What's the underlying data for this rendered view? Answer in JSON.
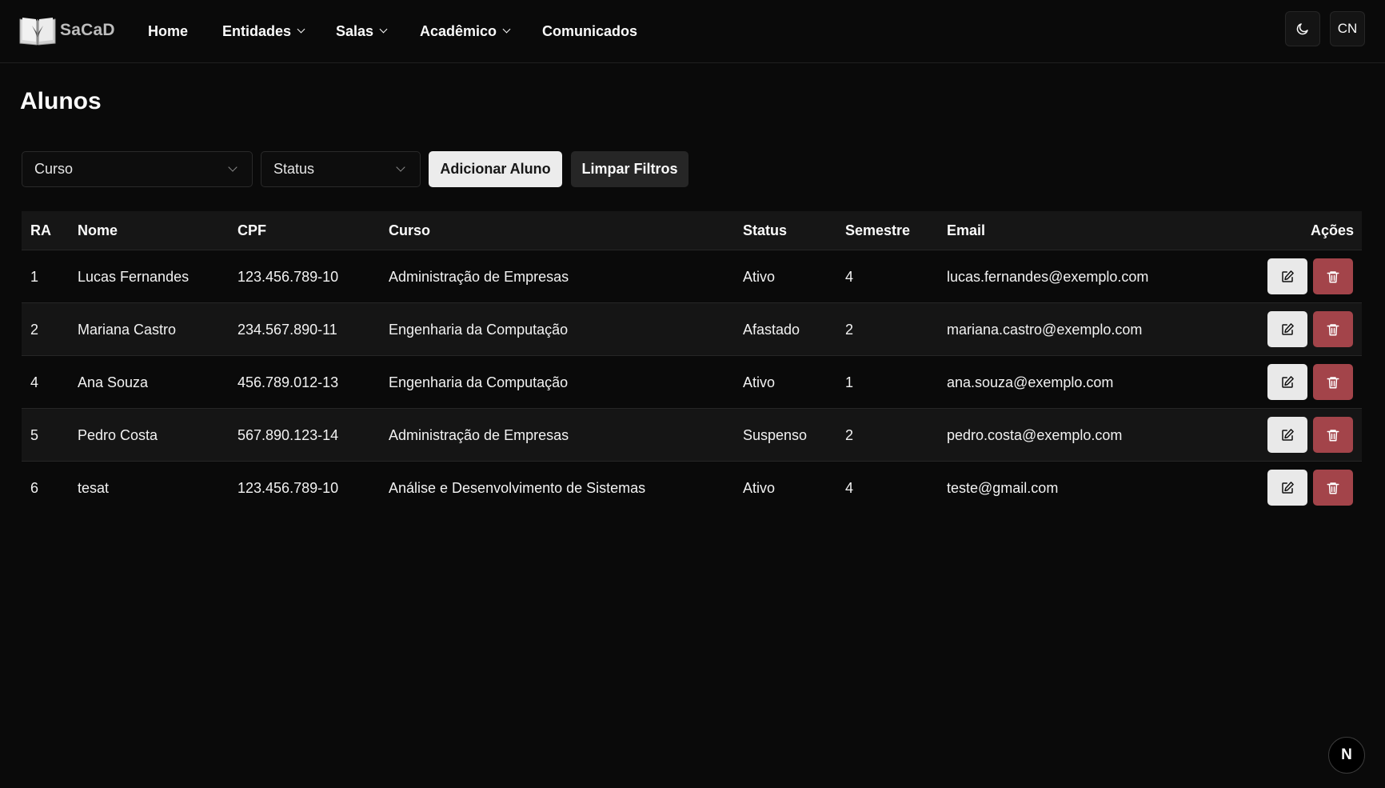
{
  "brand": {
    "name": "SaCaD"
  },
  "nav": {
    "home": "Home",
    "entidades": "Entidades",
    "salas": "Salas",
    "academico": "Acadêmico",
    "comunicados": "Comunicados"
  },
  "header_actions": {
    "theme_icon": "moon-icon",
    "avatar_initials": "CN"
  },
  "page": {
    "title": "Alunos"
  },
  "filters": {
    "curso_value": "Curso",
    "status_value": "Status",
    "add_label": "Adicionar Aluno",
    "clear_label": "Limpar Filtros"
  },
  "table": {
    "headers": {
      "ra": "RA",
      "nome": "Nome",
      "cpf": "CPF",
      "curso": "Curso",
      "status": "Status",
      "semestre": "Semestre",
      "email": "Email",
      "acoes": "Ações"
    },
    "rows": [
      {
        "ra": "1",
        "nome": "Lucas Fernandes",
        "cpf": "123.456.789-10",
        "curso": "Administração de Empresas",
        "status": "Ativo",
        "semestre": "4",
        "email": "lucas.fernandes@exemplo.com"
      },
      {
        "ra": "2",
        "nome": "Mariana Castro",
        "cpf": "234.567.890-11",
        "curso": "Engenharia da Computação",
        "status": "Afastado",
        "semestre": "2",
        "email": "mariana.castro@exemplo.com"
      },
      {
        "ra": "4",
        "nome": "Ana Souza",
        "cpf": "456.789.012-13",
        "curso": "Engenharia da Computação",
        "status": "Ativo",
        "semestre": "1",
        "email": "ana.souza@exemplo.com"
      },
      {
        "ra": "5",
        "nome": "Pedro Costa",
        "cpf": "567.890.123-14",
        "curso": "Administração de Empresas",
        "status": "Suspenso",
        "semestre": "2",
        "email": "pedro.costa@exemplo.com"
      },
      {
        "ra": "6",
        "nome": "tesat",
        "cpf": "123.456.789-10",
        "curso": "Análise e Desenvolvimento de Sistemas",
        "status": "Ativo",
        "semestre": "4",
        "email": "teste@gmail.com"
      }
    ],
    "row_actions": {
      "edit_icon": "edit-icon",
      "delete_icon": "trash-icon"
    }
  },
  "dev_badge": {
    "letter": "N"
  },
  "colors": {
    "background": "#0a0a0a",
    "header_row": "#161616",
    "alt_row": "#151515",
    "delete_button": "#a3444a",
    "light_button": "#ececec"
  }
}
